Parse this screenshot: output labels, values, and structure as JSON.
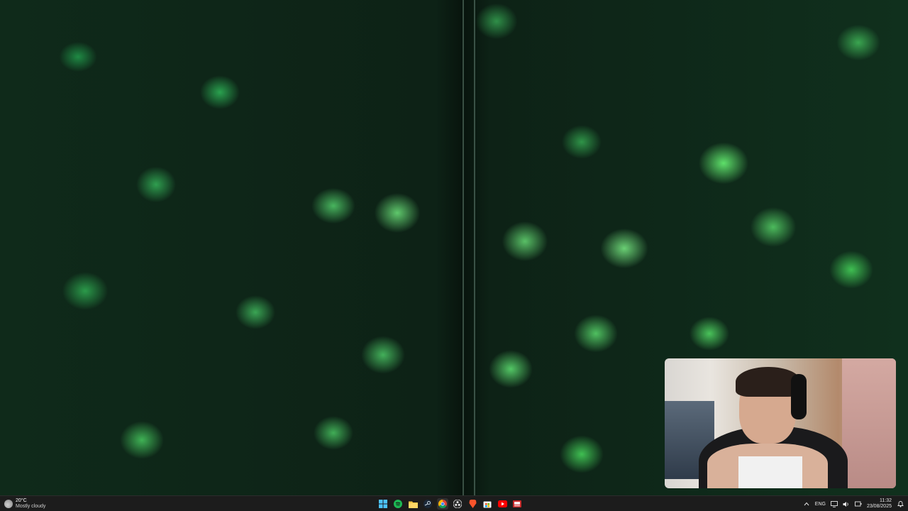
{
  "wallpaper": {
    "description_colors": [
      "#0f2a1a",
      "#3fbf52",
      "#5ee06a"
    ]
  },
  "webcam_overlay": {
    "visible": true
  },
  "taskbar": {
    "weather": {
      "temperature": "20°C",
      "condition": "Mostly cloudy",
      "icon": "partly-cloudy-icon"
    },
    "apps": [
      {
        "name": "start",
        "icon": "windows-start-icon",
        "active": false
      },
      {
        "name": "spotify",
        "icon": "spotify-icon",
        "active": false
      },
      {
        "name": "file-explorer",
        "icon": "folder-icon",
        "active": false
      },
      {
        "name": "steam",
        "icon": "steam-icon",
        "active": false
      },
      {
        "name": "chrome",
        "icon": "chrome-icon",
        "active": true
      },
      {
        "name": "obs",
        "icon": "obs-icon",
        "active": false
      },
      {
        "name": "brave",
        "icon": "brave-icon",
        "active": false
      },
      {
        "name": "store",
        "icon": "store-icon",
        "active": false
      },
      {
        "name": "youtube",
        "icon": "youtube-icon",
        "active": false
      },
      {
        "name": "recorder",
        "icon": "recorder-icon",
        "active": false
      }
    ],
    "tray": {
      "language": "ENG",
      "time": "11:32",
      "date": "23/08/2025"
    },
    "colors": {
      "background": "#1c1c1c",
      "spotify": "#1db954",
      "youtube": "#ff0000",
      "windows": "#4cc2ff"
    }
  }
}
